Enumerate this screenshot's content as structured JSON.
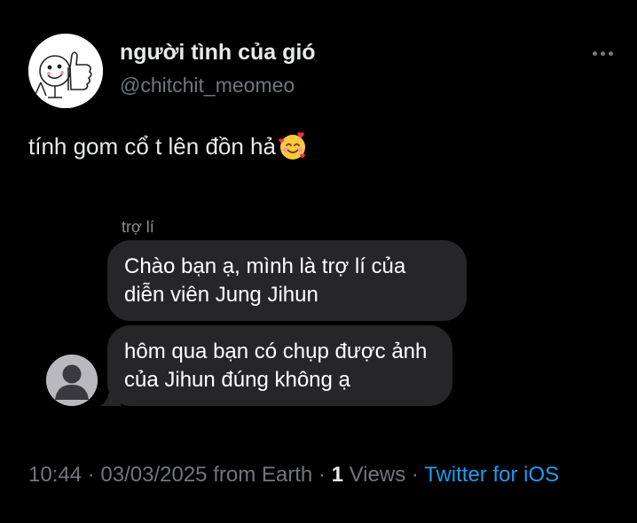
{
  "tweet": {
    "author_name": "người tình của gió",
    "author_handle": "@chitchit_meomeo",
    "text": "tính gom cổ t lên đồn hả",
    "emoji": "smiling-face-with-hearts",
    "embedded_chat": {
      "sender_label": "trợ lí",
      "messages": [
        "Chào bạn ạ, mình là trợ lí của diễn viên Jung Jihun",
        "hôm qua bạn có chụp được ảnh của Jihun đúng không ạ"
      ]
    },
    "footer": {
      "time": "10:44",
      "separator": "·",
      "date": "03/03/2025 from Earth",
      "views_count": "1",
      "views_label": "Views",
      "source": "Twitter for iOS"
    }
  },
  "colors": {
    "background": "#000000",
    "text": "#e7e9ea",
    "muted": "#71767b",
    "bubble": "#262628",
    "link": "#1d9bf0"
  }
}
